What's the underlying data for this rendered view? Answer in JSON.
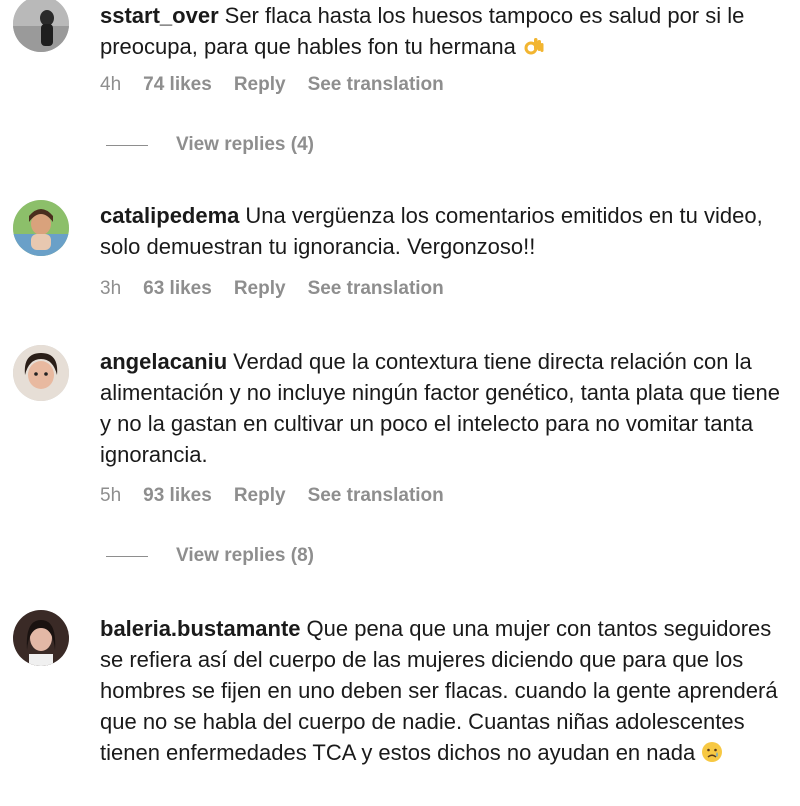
{
  "comments": [
    {
      "username": "sstart_over",
      "text": "Ser flaca hasta los huesos tampoco es salud por si le preocupa, para que hables fon tu hermana",
      "emoji": "ok-hand-emoji",
      "time": "4h",
      "likes": "74 likes",
      "reply": "Reply",
      "translate": "See translation",
      "view_replies": "View replies (4)"
    },
    {
      "username": "catalipedema",
      "text": "Una vergüenza los comentarios emitidos en tu video, solo demuestran tu ignorancia. Vergonzoso!!",
      "time": "3h",
      "likes": "63 likes",
      "reply": "Reply",
      "translate": "See translation"
    },
    {
      "username": "angelacaniu",
      "text": "Verdad que la contextura tiene directa relación con la alimentación y no incluye ningún factor genético, tanta plata que tiene y no la gastan en cultivar un poco el intelecto para no vomitar tanta ignorancia.",
      "time": "5h",
      "likes": "93 likes",
      "reply": "Reply",
      "translate": "See translation",
      "view_replies": "View replies (8)"
    },
    {
      "username": "baleria.bustamante",
      "text": "Que pena que una mujer con tantos seguidores se refiera así del cuerpo de las mujeres diciendo que para que los hombres se fijen en uno deben ser flacas. cuando la gente aprenderá que no se habla del cuerpo de nadie. Cuantas niñas adolescentes tienen enfermedades TCA y estos dichos no ayudan en nada",
      "emoji": "crying-face-emoji"
    }
  ],
  "colors": {
    "text": "#1a1a1a",
    "muted": "#8e8e8e",
    "background": "#ffffff"
  }
}
